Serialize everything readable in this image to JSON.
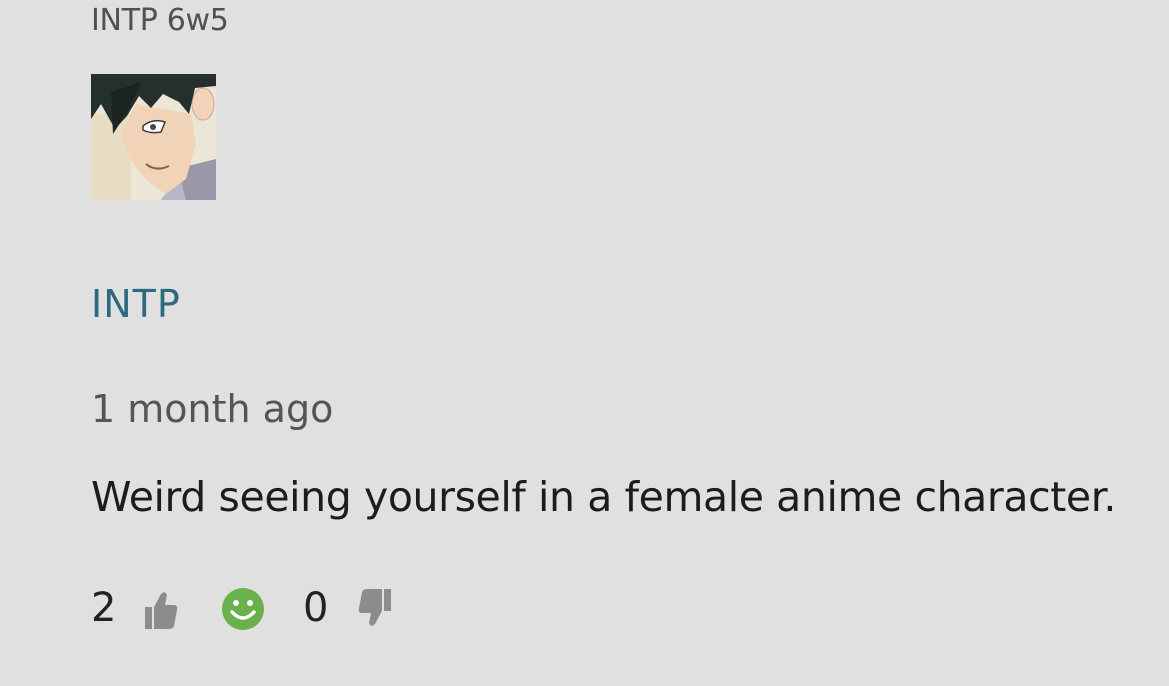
{
  "profile": {
    "header_type": "INTP 6w5",
    "avatar": "anime-character-avatar",
    "username": "INTP"
  },
  "comment": {
    "timestamp": "1 month ago",
    "text": "Weird seeing yourself in a female anime character."
  },
  "reactions": {
    "likes": "2",
    "dislikes": "0",
    "like_icon": "thumbs-up-icon",
    "smile_icon": "smiley-icon",
    "dislike_icon": "thumbs-down-icon"
  },
  "colors": {
    "background": "#e0e0e0",
    "username": "#2e6a7f",
    "smiley": "#6ab04c",
    "thumb": "#8c8c8c"
  }
}
